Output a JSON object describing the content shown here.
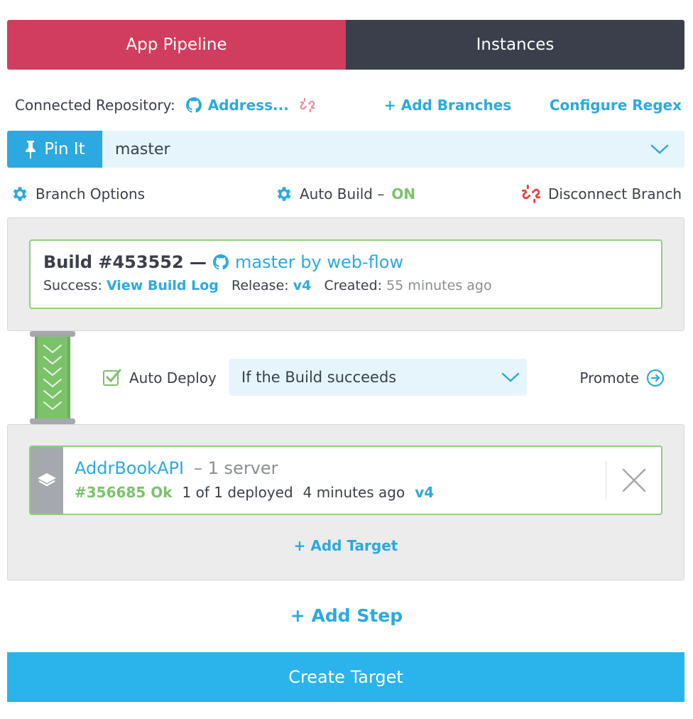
{
  "tabs": {
    "pipeline": "App Pipeline",
    "instances": "Instances"
  },
  "repo": {
    "label": "Connected Repository:",
    "name": "Address...",
    "add_branches": "+ Add Branches",
    "configure_regex": "Configure Regex"
  },
  "branch": {
    "pin_label": "Pin It",
    "selected": "master"
  },
  "options": {
    "branch_options": "Branch Options",
    "auto_build": "Auto Build –",
    "auto_build_state": "ON",
    "disconnect": "Disconnect Branch"
  },
  "build": {
    "number": "Build #453552 —",
    "branch_by": "master by web-flow",
    "status_label": "Success:",
    "log_link": "View Build Log",
    "release_label": "Release:",
    "release": "v4",
    "created_label": "Created:",
    "created": "55 minutes ago"
  },
  "deploy": {
    "auto_label": "Auto Deploy",
    "condition": "If the Build succeeds",
    "promote": "Promote"
  },
  "target": {
    "name": "AddrBookAPI",
    "servers": "– 1 server",
    "deploy_id": "#356685 Ok",
    "deployed": "1 of 1 deployed",
    "time": "4 minutes ago",
    "release": "v4",
    "add_target": "+ Add Target"
  },
  "add_step": "+ Add Step",
  "create_target": "Create Target",
  "colors": {
    "pipeline_tab": "#d13d5f",
    "instances_tab": "#3a3f4b",
    "accent_blue": "#2ba9e0",
    "success_green": "#7cc26a",
    "create_button": "#2bb3ec"
  }
}
